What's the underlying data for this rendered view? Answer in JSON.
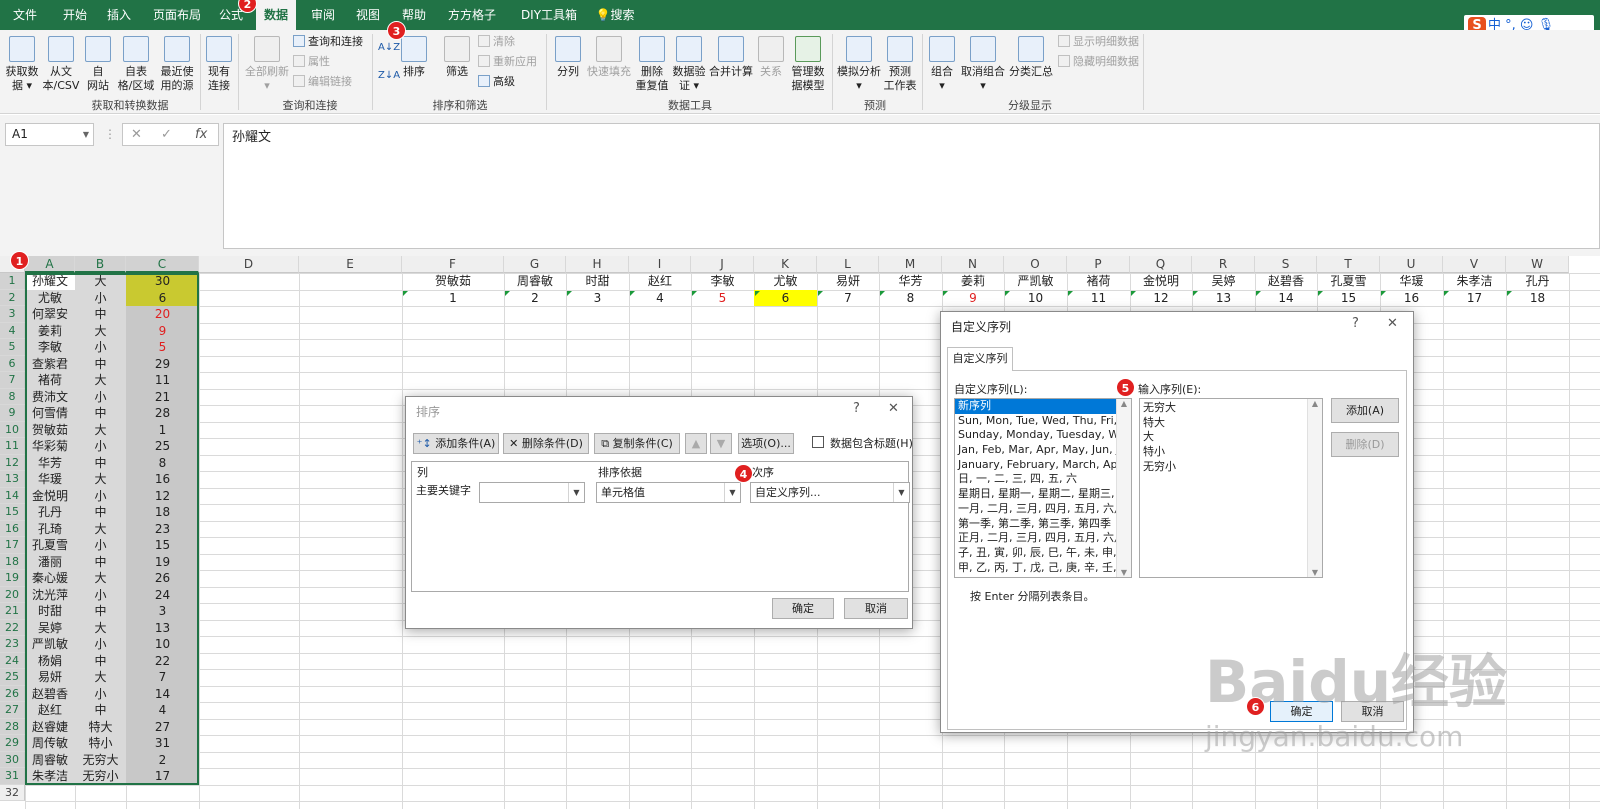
{
  "tabs": [
    "文件",
    "开始",
    "插入",
    "页面布局",
    "公式",
    "数据",
    "审阅",
    "视图",
    "帮助",
    "方方格子",
    "DIY工具箱",
    "搜索"
  ],
  "tray_text": "中 °,",
  "ribbon": {
    "get_data": "获取数\n据 ▾",
    "from_csv": "从文\n本/CSV",
    "from_web": "自\n网站",
    "from_table": "自表\n格/区域",
    "recent_sources": "最近使\n用的源",
    "existing_conn": "现有\n连接",
    "refresh_all": "全部刷新\n▾",
    "queries_conn": "查询和连接",
    "properties": "属性",
    "edit_links": "编辑链接",
    "sort_btn": "排序",
    "filter_btn": "筛选",
    "clear": "清除",
    "reapply": "重新应用",
    "advanced": "高级",
    "split_col": "分列",
    "flash_fill": "快速填充",
    "remove_dup": "删除\n重复值",
    "validation": "数据验\n证 ▾",
    "consolidate": "合并计算",
    "relations": "关系",
    "data_model": "管理数\n据模型",
    "whatif": "模拟分析\n▾",
    "forecast": "预测\n工作表",
    "group": "组合\n▾",
    "ungroup": "取消组合\n▾",
    "subtotal": "分类汇总",
    "show_detail": "显示明细数据",
    "hide_detail": "隐藏明细数据",
    "groups": [
      "获取和转换数据",
      "查询和连接",
      "排序和筛选",
      "数据工具",
      "预测",
      "分级显示"
    ]
  },
  "namebox": "A1",
  "formula": "孙耀文",
  "formula_icons": [
    "✕",
    "✓",
    "fx"
  ],
  "columns": [
    "A",
    "B",
    "C",
    "D",
    "E",
    "F",
    "G",
    "H",
    "I",
    "J",
    "K",
    "L",
    "M",
    "N",
    "O",
    "P",
    "Q",
    "R",
    "S",
    "T",
    "U",
    "V",
    "W"
  ],
  "rows": [
    "1",
    "2",
    "3",
    "4",
    "5",
    "6",
    "7",
    "8",
    "9",
    "10",
    "11",
    "12",
    "13",
    "14",
    "15",
    "16",
    "17",
    "18",
    "19",
    "20",
    "21",
    "22",
    "23",
    "24",
    "25",
    "26",
    "27",
    "28",
    "29",
    "30",
    "31",
    "32"
  ],
  "data_rows": [
    [
      "孙耀文",
      "大",
      "30"
    ],
    [
      "尤敏",
      "小",
      "6"
    ],
    [
      "何翠安",
      "中",
      "20"
    ],
    [
      "姜莉",
      "大",
      "9"
    ],
    [
      "李敏",
      "小",
      "5"
    ],
    [
      "查紫君",
      "中",
      "29"
    ],
    [
      "褚荷",
      "大",
      "11"
    ],
    [
      "费沛文",
      "小",
      "21"
    ],
    [
      "何雪倩",
      "中",
      "28"
    ],
    [
      "贺敏茹",
      "大",
      "1"
    ],
    [
      "华彩菊",
      "小",
      "25"
    ],
    [
      "华芳",
      "中",
      "8"
    ],
    [
      "华瑗",
      "大",
      "16"
    ],
    [
      "金悦明",
      "小",
      "12"
    ],
    [
      "孔丹",
      "中",
      "18"
    ],
    [
      "孔琦",
      "大",
      "23"
    ],
    [
      "孔夏雪",
      "小",
      "15"
    ],
    [
      "潘丽",
      "中",
      "19"
    ],
    [
      "秦心媛",
      "大",
      "26"
    ],
    [
      "沈光萍",
      "小",
      "24"
    ],
    [
      "时甜",
      "中",
      "3"
    ],
    [
      "吴婷",
      "大",
      "13"
    ],
    [
      "严凯敏",
      "小",
      "10"
    ],
    [
      "杨娟",
      "中",
      "22"
    ],
    [
      "易妍",
      "大",
      "7"
    ],
    [
      "赵碧香",
      "小",
      "14"
    ],
    [
      "赵红",
      "中",
      "4"
    ],
    [
      "赵睿婕",
      "特大",
      "27"
    ],
    [
      "周传敏",
      "特小",
      "31"
    ],
    [
      "周睿敏",
      "无穷大",
      "2"
    ],
    [
      "朱孝洁",
      "无穷小",
      "17"
    ]
  ],
  "row1_names": [
    "贺敏茹",
    "周睿敏",
    "时甜",
    "赵红",
    "李敏",
    "尤敏",
    "易妍",
    "华芳",
    "姜莉",
    "严凯敏",
    "褚荷",
    "金悦明",
    "吴婷",
    "赵碧香",
    "孔夏雪",
    "华瑗",
    "朱孝洁",
    "孔丹"
  ],
  "row2_nums": [
    "1",
    "2",
    "3",
    "4",
    "5",
    "6",
    "7",
    "8",
    "9",
    "10",
    "11",
    "12",
    "13",
    "14",
    "15",
    "16",
    "17",
    "18"
  ],
  "sort_dialog": {
    "title": "排序",
    "help": "?",
    "close": "✕",
    "add": "添加条件(A)",
    "delete": "删除条件(D)",
    "copy": "复制条件(C)",
    "options": "选项(O)...",
    "header_check": "数据包含标题(H)",
    "col_hdr": "列",
    "basis_hdr": "排序依据",
    "order_hdr": "次序",
    "primary_key": "主要关键字",
    "key_value": "",
    "basis_value": "单元格值",
    "order_value": "自定义序列...",
    "ok": "确定",
    "cancel": "取消"
  },
  "custom_dialog": {
    "title": "自定义序列",
    "help": "?",
    "close": "✕",
    "tab": "自定义序列",
    "list_label": "自定义序列(L):",
    "input_label": "输入序列(E):",
    "lists": [
      "新序列",
      "Sun, Mon, Tue, Wed, Thu, Fri, S",
      "Sunday, Monday, Tuesday, Wed",
      "Jan, Feb, Mar, Apr, May, Jun, Ju",
      "January, February, March, April",
      "日, 一, 二, 三, 四, 五, 六",
      "星期日, 星期一, 星期二, 星期三, 星",
      "一月, 二月, 三月, 四月, 五月, 六月,",
      "第一季, 第二季, 第三季, 第四季",
      "正月, 二月, 三月, 四月, 五月, 六月,",
      "子, 丑, 寅, 卯, 辰, 巳, 午, 未, 申, 酉",
      "甲, 乙, 丙, 丁, 戊, 己, 庚, 辛, 壬, 癸"
    ],
    "entries": [
      "无穷大",
      "特大",
      "大",
      "特小",
      "无穷小"
    ],
    "add": "添加(A)",
    "delete": "删除(D)",
    "hint": "按 Enter 分隔列表条目。",
    "ok": "确定",
    "cancel": "取消"
  },
  "badges": [
    "1",
    "2",
    "3",
    "4",
    "5",
    "6"
  ],
  "watermark": "Baidu经验",
  "watermark_url": "jingyan.baidu.com"
}
